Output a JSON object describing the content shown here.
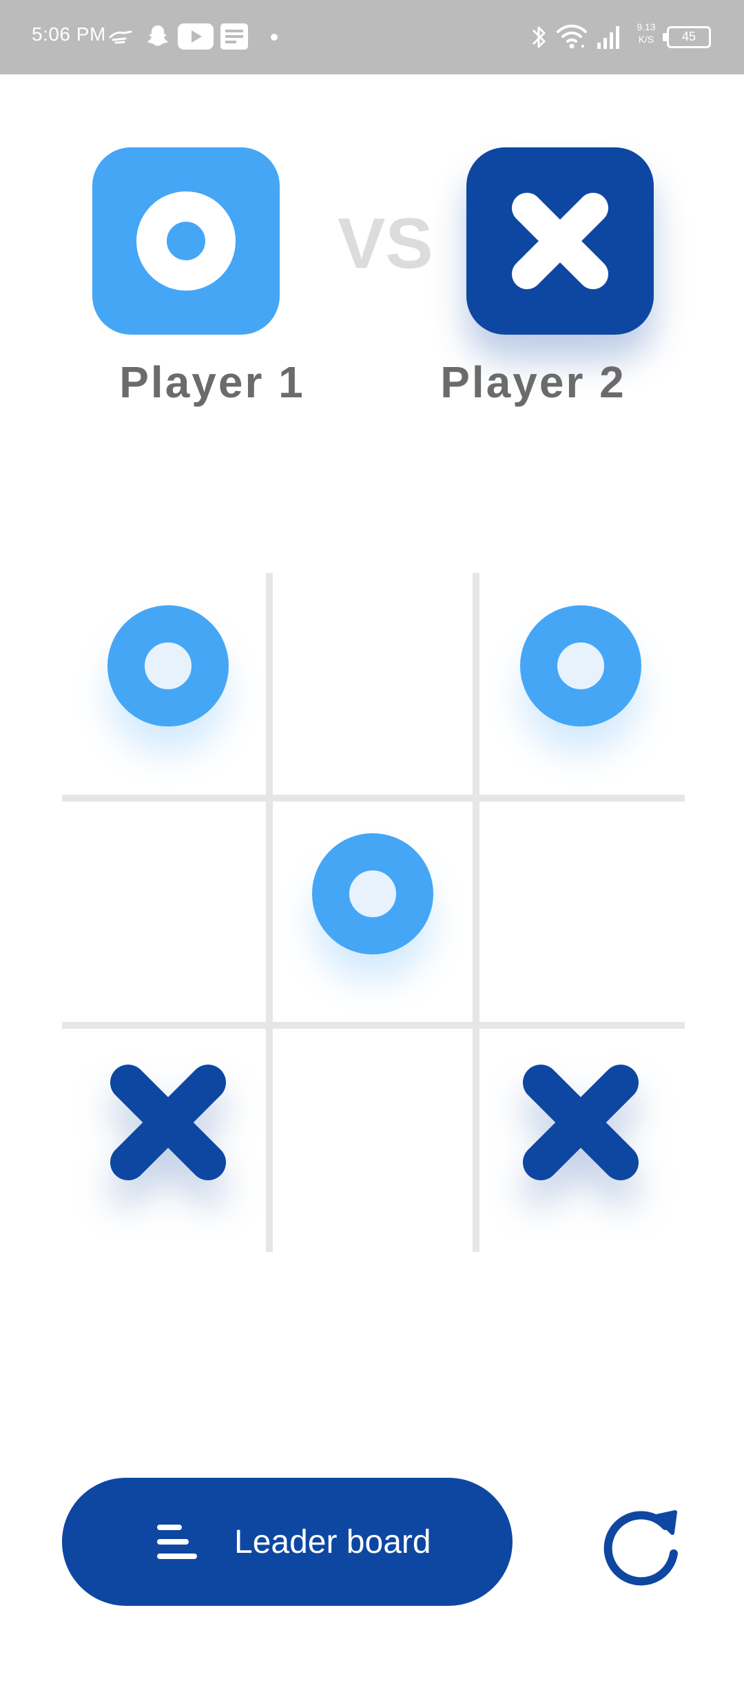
{
  "status_bar": {
    "time": "5:06 PM",
    "left_icons": [
      "hand-gesture-icon",
      "snapchat-icon",
      "youtube-icon",
      "news-icon",
      "notification-dot-icon"
    ],
    "right_icons": [
      "bluetooth-icon",
      "wifi-icon",
      "signal-icon"
    ],
    "network_speed_value": "9.13",
    "network_speed_unit": "K/S",
    "battery": "45"
  },
  "players": {
    "player1": {
      "name": "Player 1",
      "symbol": "O",
      "color": "#45a6f6"
    },
    "player2": {
      "name": "Player 2",
      "symbol": "X",
      "color": "#0e47a1"
    },
    "vs_label": "VS"
  },
  "board": {
    "cells": [
      "O",
      "",
      "O",
      "",
      "O",
      "",
      "X",
      "",
      "X"
    ],
    "line_color": "#e6e6e6"
  },
  "actions": {
    "leaderboard_label": "Leader board",
    "leaderboard_icon": "menu-icon",
    "restart_icon": "restart-icon"
  }
}
